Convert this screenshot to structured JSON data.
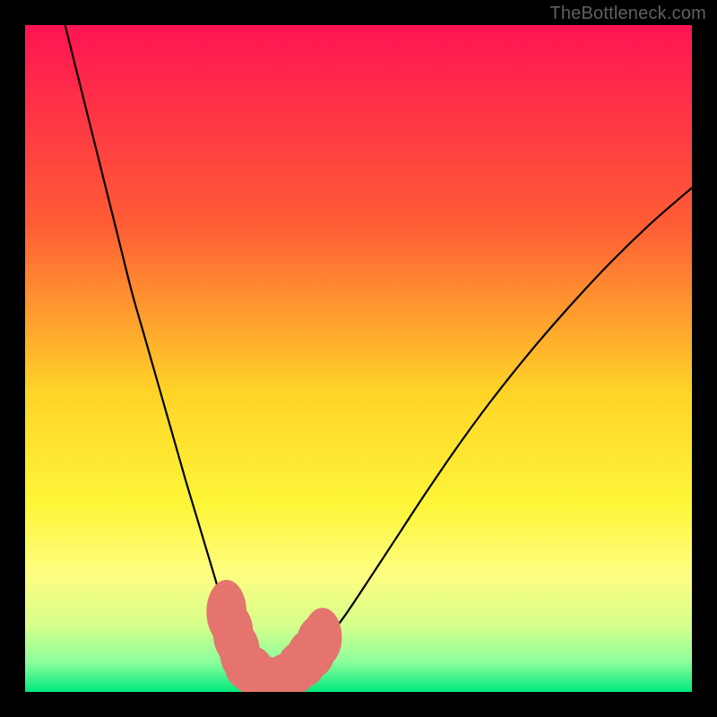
{
  "watermark": "TheBottleneck.com",
  "chart_data": {
    "type": "line",
    "title": "",
    "xlabel": "",
    "ylabel": "",
    "xlim": [
      0,
      100
    ],
    "ylim": [
      0,
      100
    ],
    "background_gradient": {
      "stops": [
        {
          "offset": 0.0,
          "color": "#ff1452"
        },
        {
          "offset": 0.3,
          "color": "#ff5d35"
        },
        {
          "offset": 0.55,
          "color": "#ffd427"
        },
        {
          "offset": 0.72,
          "color": "#fef639"
        },
        {
          "offset": 0.82,
          "color": "#fffd80"
        },
        {
          "offset": 0.9,
          "color": "#d6ff8c"
        },
        {
          "offset": 0.955,
          "color": "#8cff9c"
        },
        {
          "offset": 1.0,
          "color": "#00e97c"
        }
      ]
    },
    "series": [
      {
        "name": "bottleneck-curve",
        "x": [
          6,
          8,
          10,
          12,
          14,
          16,
          18,
          20,
          22,
          24,
          25.5,
          27,
          28.5,
          30,
          31,
          32,
          33,
          34,
          35,
          36,
          37,
          38,
          40,
          42,
          45,
          48,
          52,
          56,
          60,
          65,
          70,
          76,
          82,
          88,
          94,
          100
        ],
        "y": [
          100,
          92,
          84,
          76,
          68,
          60,
          53,
          46,
          39,
          32,
          27,
          22,
          17,
          12,
          9,
          6.5,
          4.5,
          3.2,
          2.4,
          2.0,
          2.0,
          2.2,
          3.0,
          4.4,
          7.6,
          11.5,
          17.5,
          23.6,
          29.7,
          37.0,
          43.8,
          51.3,
          58.2,
          64.6,
          70.4,
          75.6
        ]
      }
    ],
    "markers": {
      "name": "salmon-marker",
      "color": "#e4746d",
      "type": "lozenge",
      "points": [
        {
          "x": 30.2,
          "y": 12.0,
          "rx": 3.0,
          "ry": 4.8
        },
        {
          "x": 31.2,
          "y": 8.8,
          "rx": 3.0,
          "ry": 4.6
        },
        {
          "x": 32.2,
          "y": 6.0,
          "rx": 3.0,
          "ry": 4.4
        },
        {
          "x": 33.6,
          "y": 3.6,
          "rx": 3.6,
          "ry": 3.4
        },
        {
          "x": 35.4,
          "y": 2.4,
          "rx": 4.6,
          "ry": 3.0
        },
        {
          "x": 37.6,
          "y": 2.1,
          "rx": 4.6,
          "ry": 3.0
        },
        {
          "x": 39.4,
          "y": 2.6,
          "rx": 3.6,
          "ry": 3.2
        },
        {
          "x": 40.8,
          "y": 3.6,
          "rx": 3.0,
          "ry": 3.8
        },
        {
          "x": 42.2,
          "y": 5.0,
          "rx": 3.0,
          "ry": 4.2
        },
        {
          "x": 43.6,
          "y": 6.8,
          "rx": 3.0,
          "ry": 4.6
        },
        {
          "x": 44.6,
          "y": 8.2,
          "rx": 2.9,
          "ry": 4.4
        }
      ]
    }
  }
}
